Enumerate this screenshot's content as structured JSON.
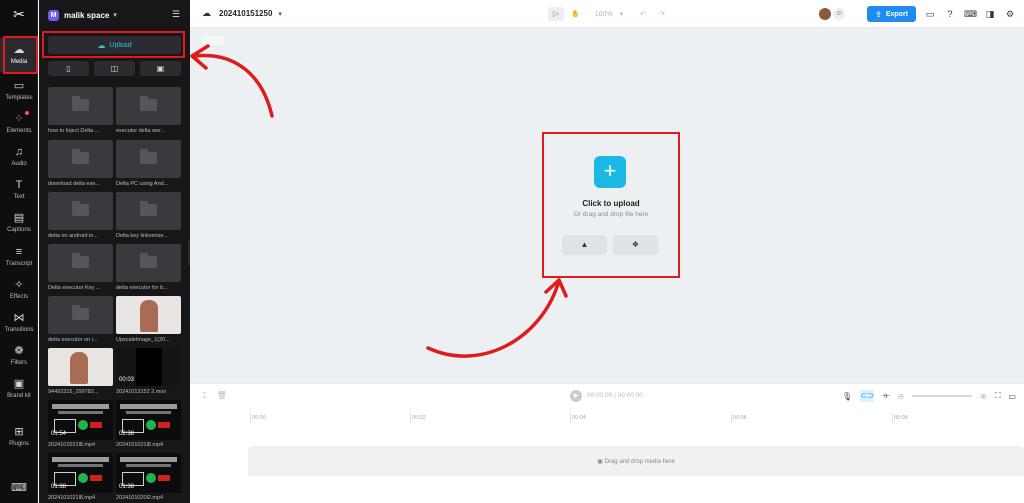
{
  "rail": {
    "logo": "capcut-logo-icon",
    "items": [
      {
        "label": "Media",
        "icon": "media-cloud-icon"
      },
      {
        "label": "Templates",
        "icon": "templates-icon"
      },
      {
        "label": "Elements",
        "icon": "elements-icon"
      },
      {
        "label": "Audio",
        "icon": "audio-icon"
      },
      {
        "label": "Text",
        "icon": "text-icon"
      },
      {
        "label": "Captions",
        "icon": "captions-icon"
      },
      {
        "label": "Transcript",
        "icon": "transcript-icon"
      },
      {
        "label": "Effects",
        "icon": "effects-icon"
      },
      {
        "label": "Transitions",
        "icon": "transitions-icon"
      },
      {
        "label": "Filters",
        "icon": "filters-icon"
      },
      {
        "label": "Brand kit",
        "icon": "brand-kit-icon"
      },
      {
        "label": "Plugins",
        "icon": "plugins-icon"
      }
    ]
  },
  "panel": {
    "space_badge": "M",
    "space_name": "malik space",
    "upload_label": "Upload",
    "items": [
      {
        "caption": "how to Inject Delta ..."
      },
      {
        "caption": "executor delta wor..."
      },
      {
        "caption": "download delta exe..."
      },
      {
        "caption": "Delta PC using And..."
      },
      {
        "caption": "delta on android in..."
      },
      {
        "caption": "Delta key linkverise..."
      },
      {
        "caption": "Delta executor Key ..."
      },
      {
        "caption": "delta executor for b..."
      },
      {
        "caption": "delta executor on i..."
      },
      {
        "caption": "UpscaleImage_1(20..."
      },
      {
        "caption": "94492315_299782..."
      },
      {
        "caption": "20241013152 2.mov",
        "duration": "00:03"
      },
      {
        "caption": "2024101021l8.mp4",
        "duration": "01:54"
      },
      {
        "caption": "2024101021l8.mp4",
        "duration": "02:38"
      },
      {
        "caption": "2024101021l8.mp4",
        "duration": "01:38"
      },
      {
        "caption": "2024101020l2.mp4",
        "duration": "01:38"
      }
    ]
  },
  "topbar": {
    "project_name": "202410151250",
    "zoom": "100%",
    "export_label": "Export"
  },
  "canvas": {
    "click_to_upload": "Click to upload",
    "drag_hint": "Or drag and drop file here"
  },
  "timeline": {
    "timecode": "00:00:00 | 00:00:00",
    "ticks": [
      "00:00",
      "00:02",
      "00:04",
      "00:06",
      "00:08"
    ],
    "drop_label": "Drag and drop media here"
  },
  "colors": {
    "accent": "#19b9e3",
    "export": "#1f8cf2",
    "annotation_red": "#e01b1b"
  }
}
